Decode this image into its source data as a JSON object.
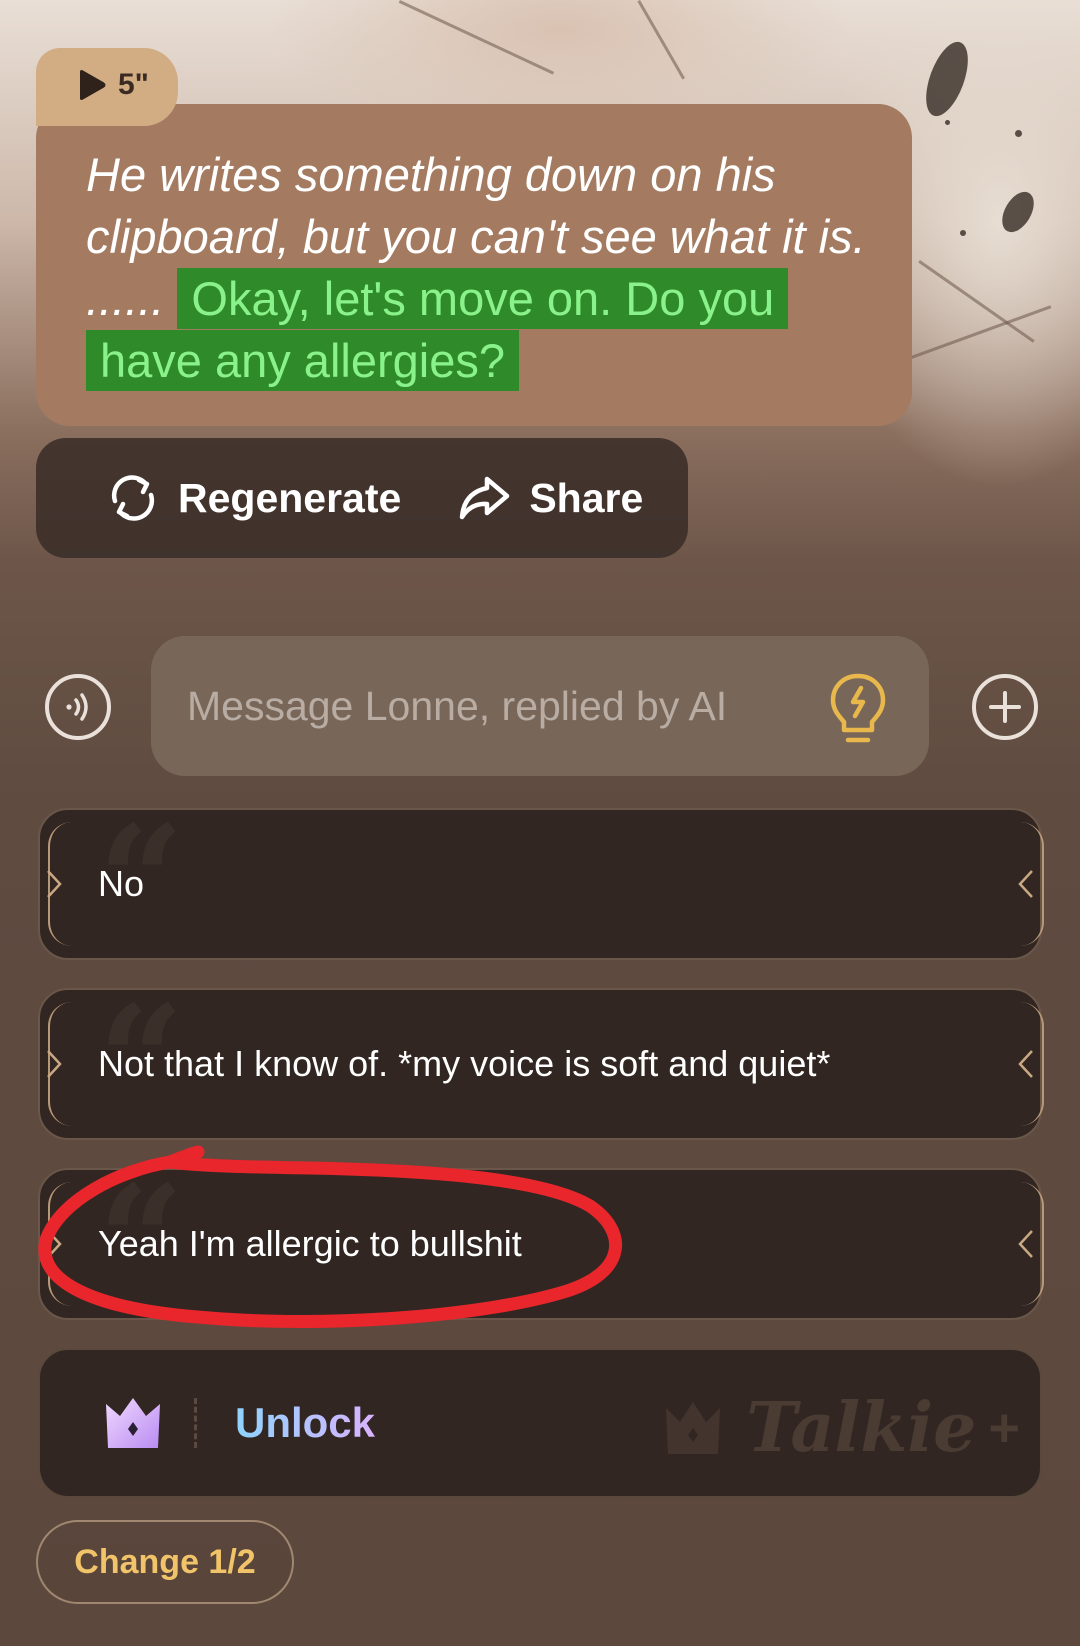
{
  "narration": {
    "duration": "5\"",
    "action_text": "He writes something down on his clipboard, but you can't see what it is. ......",
    "speech_text": "Okay, let's move on. Do you have any allergies?"
  },
  "actions": {
    "regenerate_label": "Regenerate",
    "share_label": "Share"
  },
  "composer": {
    "placeholder": "Message Lonne, replied by AI"
  },
  "replies": [
    {
      "text": "No"
    },
    {
      "text": "Not that I know of. *my voice is soft and quiet*"
    },
    {
      "text": "Yeah I'm allergic to bullshit"
    }
  ],
  "unlock": {
    "label": "Unlock",
    "brand": "Talkie",
    "brand_suffix": "+"
  },
  "change_button": "Change 1/2",
  "colors": {
    "speech_highlight": "#2f8a29",
    "speech_text": "#8af28a",
    "bubble": "#a47b60",
    "change_text": "#f2c46a",
    "annotation": "#e8262c"
  }
}
